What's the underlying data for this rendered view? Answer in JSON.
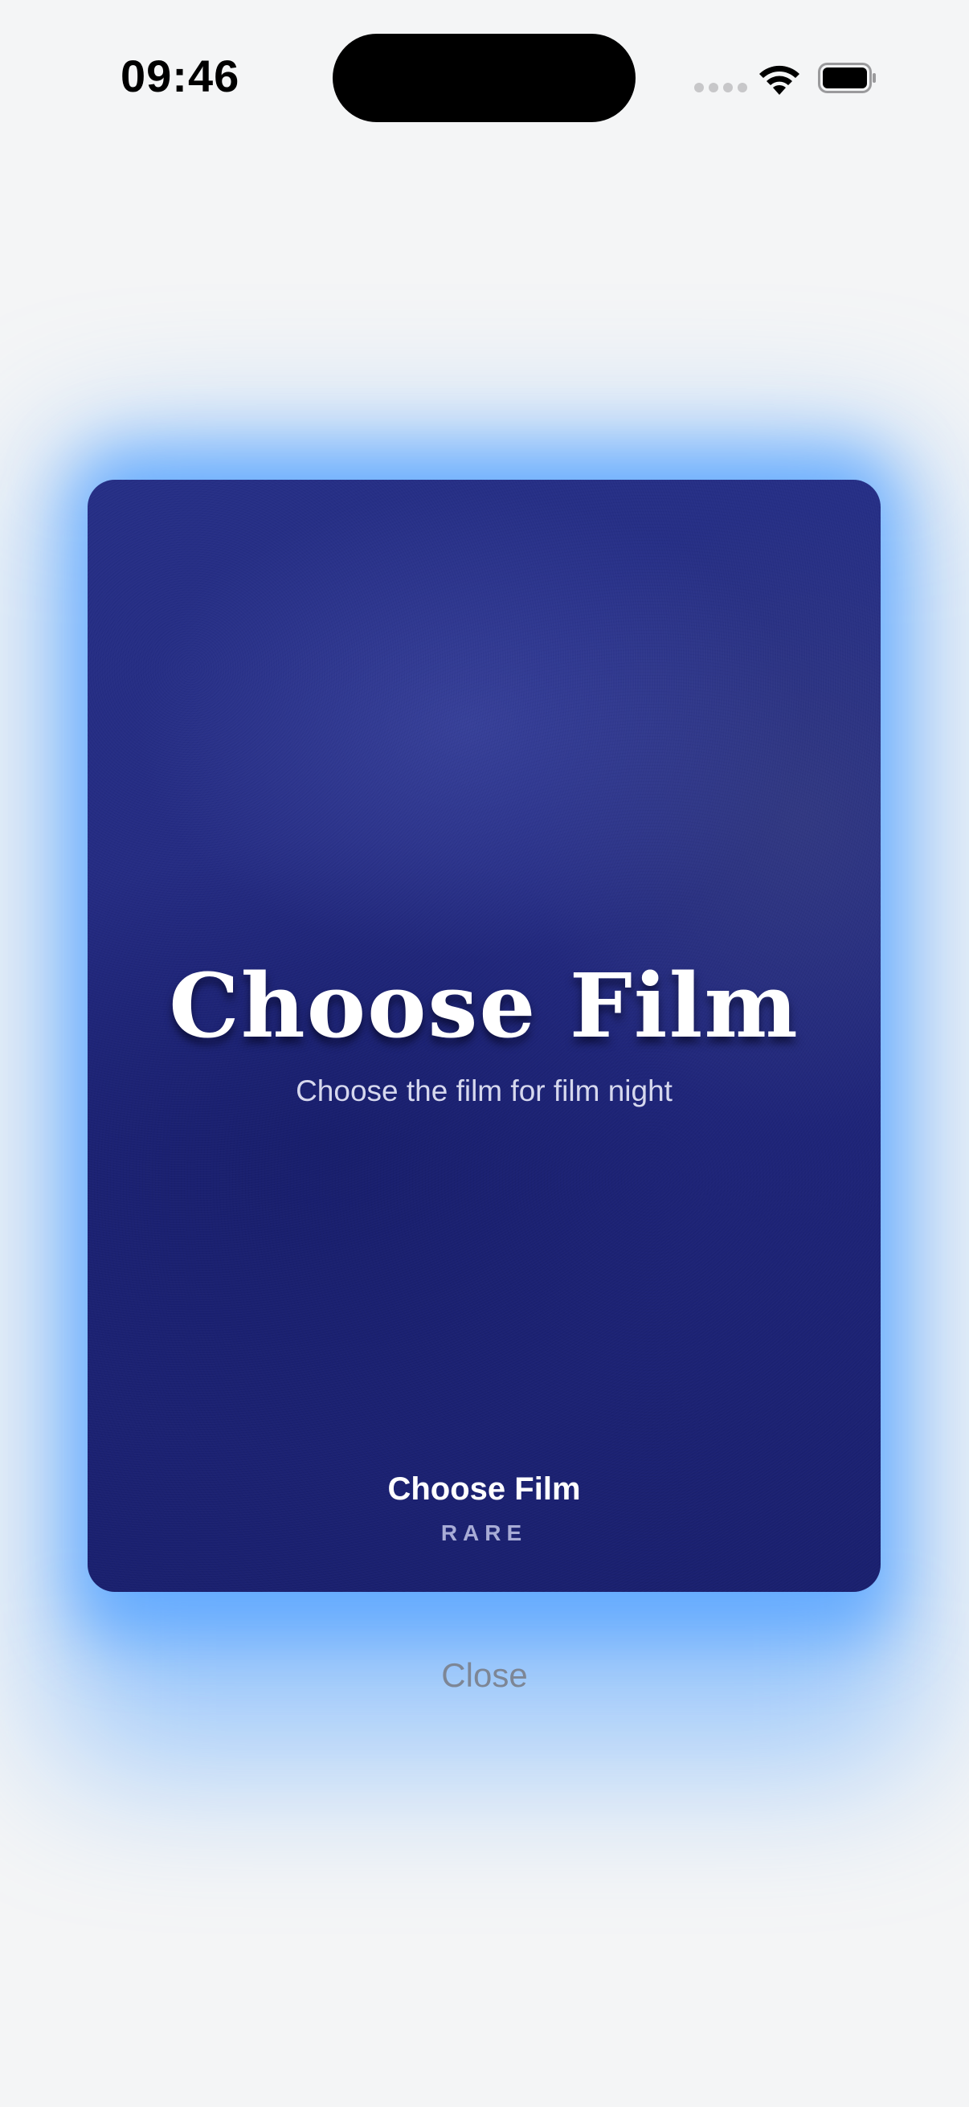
{
  "status_bar": {
    "time": "09:46",
    "wifi_icon": "wifi-icon",
    "battery_icon": "battery-icon",
    "signal_icon": "cellular-signal-icon"
  },
  "card": {
    "title": "Choose Film",
    "subtitle": "Choose the film for film night",
    "name": "Choose Film",
    "rarity": "RARE",
    "colors": {
      "background": "#252c83",
      "glow": "#5aa5ff"
    }
  },
  "actions": {
    "close_label": "Close"
  }
}
